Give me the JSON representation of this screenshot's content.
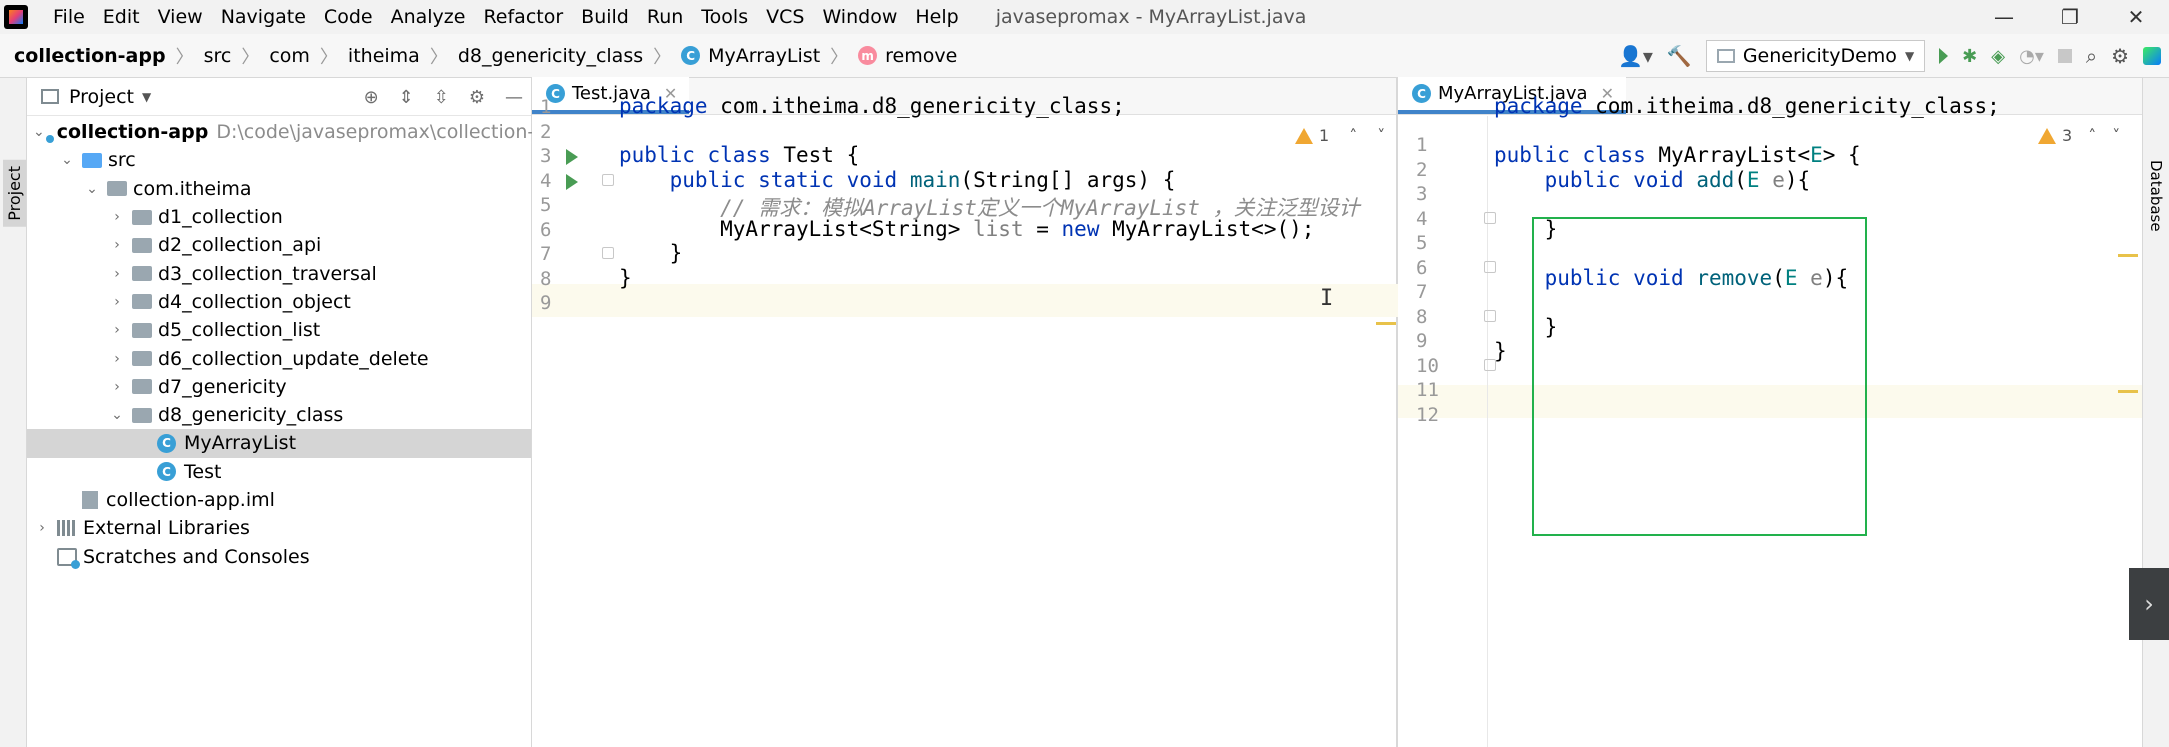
{
  "window": {
    "menu": [
      "File",
      "Edit",
      "View",
      "Navigate",
      "Code",
      "Analyze",
      "Refactor",
      "Build",
      "Run",
      "Tools",
      "VCS",
      "Window",
      "Help"
    ],
    "title": "javasepromax - MyArrayList.java",
    "controls": {
      "minimize": "—",
      "restore": "❐",
      "close": "✕"
    }
  },
  "breadcrumb": {
    "project": "collection-app",
    "items": [
      "src",
      "com",
      "itheima",
      "d8_genericity_class"
    ],
    "class_name": "MyArrayList",
    "method_name": "remove",
    "class_icon_letter": "C",
    "method_icon_letter": "m"
  },
  "toolbar": {
    "run_config": "GenericityDemo"
  },
  "left_stripe": {
    "label": "Project"
  },
  "right_stripe": {
    "label": "Database"
  },
  "project_panel": {
    "title": "Project",
    "tree": [
      {
        "label": "collection-app",
        "path": "D:\\code\\javasepromax\\collection-app",
        "depth": 0,
        "arrow": "v",
        "icon": "module"
      },
      {
        "label": "src",
        "depth": 1,
        "arrow": "v",
        "icon": "src-folder"
      },
      {
        "label": "com.itheima",
        "depth": 2,
        "arrow": "v",
        "icon": "package"
      },
      {
        "label": "d1_collection",
        "depth": 3,
        "arrow": ">",
        "icon": "package"
      },
      {
        "label": "d2_collection_api",
        "depth": 3,
        "arrow": ">",
        "icon": "package"
      },
      {
        "label": "d3_collection_traversal",
        "depth": 3,
        "arrow": ">",
        "icon": "package"
      },
      {
        "label": "d4_collection_object",
        "depth": 3,
        "arrow": ">",
        "icon": "package"
      },
      {
        "label": "d5_collection_list",
        "depth": 3,
        "arrow": ">",
        "icon": "package"
      },
      {
        "label": "d6_collection_update_delete",
        "depth": 3,
        "arrow": ">",
        "icon": "package"
      },
      {
        "label": "d7_genericity",
        "depth": 3,
        "arrow": ">",
        "icon": "package"
      },
      {
        "label": "d8_genericity_class",
        "depth": 3,
        "arrow": "v",
        "icon": "package"
      },
      {
        "label": "MyArrayList",
        "depth": 4,
        "arrow": "",
        "icon": "class",
        "selected": true
      },
      {
        "label": "Test",
        "depth": 4,
        "arrow": "",
        "icon": "class-runnable"
      },
      {
        "label": "collection-app.iml",
        "depth": 1,
        "arrow": "",
        "icon": "iml"
      },
      {
        "label": "External Libraries",
        "depth": 0,
        "arrow": ">",
        "icon": "library"
      },
      {
        "label": "Scratches and Consoles",
        "depth": 0,
        "arrow": "",
        "icon": "scratches"
      }
    ]
  },
  "editor_left": {
    "tab": "Test.java",
    "warnings": "1",
    "line_numbers": [
      "1",
      "2",
      "3",
      "4",
      "5",
      "6",
      "7",
      "8",
      "9"
    ],
    "lines": [
      "package com.itheima.d8_genericity_class;",
      "",
      "public class Test {",
      "    public static void main(String[] args) {",
      "        // 需求：模拟ArrayList定义一个MyArrayList ，关注泛型设计",
      "        MyArrayList<String> list = new MyArrayList<>();",
      "    }",
      "}",
      ""
    ]
  },
  "editor_right": {
    "tab": "MyArrayList.java",
    "warnings": "3",
    "line_numbers": [
      "1",
      "2",
      "3",
      "4",
      "5",
      "6",
      "7",
      "8",
      "9",
      "10",
      "11",
      "12"
    ],
    "lines": [
      "package com.itheima.d8_genericity_class;",
      "",
      "public class MyArrayList<E> {",
      "    public void add(E e){",
      "",
      "    }",
      "",
      "    public void remove(E e){",
      "",
      "    }",
      "}",
      ""
    ]
  },
  "colors": {
    "keyword": "#0033b3",
    "method": "#00627a",
    "comment": "#8c8c8c",
    "highlight_box": "#22b14c",
    "tab_underline": "#4083c9"
  }
}
